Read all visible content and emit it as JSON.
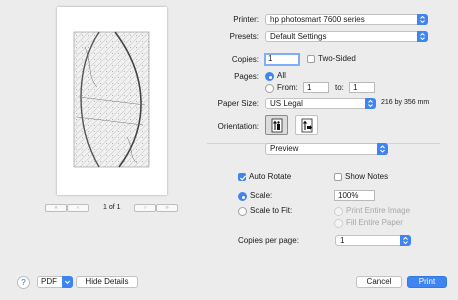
{
  "printer": {
    "label": "Printer:",
    "value": "hp photosmart 7600 series"
  },
  "presets": {
    "label": "Presets:",
    "value": "Default Settings"
  },
  "copies": {
    "label": "Copies:",
    "value": "1",
    "two_sided_label": "Two-Sided",
    "two_sided_checked": false
  },
  "pages": {
    "label": "Pages:",
    "all_label": "All",
    "from_label": "From:",
    "from_value": "1",
    "to_label": "to:",
    "to_value": "1",
    "selected": "All"
  },
  "paper_size": {
    "label": "Paper Size:",
    "value": "US Legal",
    "dimensions": "216 by 356 mm"
  },
  "orientation": {
    "label": "Orientation:",
    "selected": "portrait",
    "icons": [
      "portrait-orientation-icon",
      "landscape-orientation-icon"
    ]
  },
  "section_menu": {
    "value": "Preview"
  },
  "preview_options": {
    "auto_rotate_label": "Auto Rotate",
    "auto_rotate_checked": true,
    "show_notes_label": "Show Notes",
    "show_notes_checked": false,
    "scale_label": "Scale:",
    "scale_value": "100%",
    "scale_to_fit_label": "Scale to Fit:",
    "print_entire_image_label": "Print Entire Image",
    "fill_entire_paper_label": "Fill Entire Paper",
    "copies_per_page_label": "Copies per page:",
    "copies_per_page_value": "1"
  },
  "preview": {
    "page_indicator": "1 of 1"
  },
  "footer": {
    "help_label": "?",
    "pdf_label": "PDF",
    "hide_details_label": "Hide Details",
    "cancel_label": "Cancel",
    "print_label": "Print"
  },
  "colors": {
    "accent": "#3f85f1",
    "background": "#ececec"
  }
}
